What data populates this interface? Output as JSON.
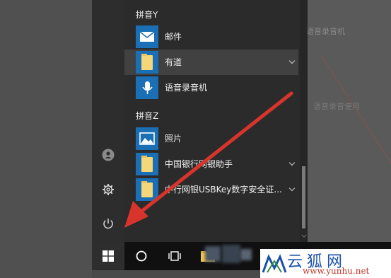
{
  "background": {
    "ghost_items": [
      {
        "id": "ghost-1",
        "text": "语音录音机"
      },
      {
        "id": "ghost-2",
        "text": "语音录音使用"
      }
    ]
  },
  "start_menu": {
    "rail": {
      "icons": [
        "user-icon",
        "settings-icon",
        "power-icon"
      ]
    },
    "groups": [
      {
        "header": "拼音Y",
        "apps": [
          {
            "label": "邮件",
            "icon": "mail-icon",
            "expandable": false,
            "highlighted": false
          },
          {
            "label": "有道",
            "icon": "folder-icon",
            "expandable": true,
            "highlighted": true
          },
          {
            "label": "语音录音机",
            "icon": "voice-recorder-icon",
            "expandable": false,
            "highlighted": false
          }
        ]
      },
      {
        "header": "拼音Z",
        "apps": [
          {
            "label": "照片",
            "icon": "photos-icon",
            "expandable": false,
            "highlighted": false
          },
          {
            "label": "中国银行网银助手",
            "icon": "folder-icon",
            "expandable": true,
            "highlighted": false
          },
          {
            "label": "中行网银USBKey数字安全证...",
            "icon": "folder-icon",
            "expandable": true,
            "highlighted": false
          }
        ]
      }
    ]
  },
  "taskbar": {
    "icons": [
      "windows-start-icon",
      "cortana-search-icon",
      "task-view-icon",
      "file-explorer-icon"
    ]
  },
  "watermark": {
    "name": "云狐网",
    "url": "www.yunhu.net"
  },
  "colors": {
    "accent_tile": "#1a6fb5",
    "arrow": "#d9342b",
    "menu_bg": "#2b2b2b",
    "taskbar_bg": "#101010"
  }
}
